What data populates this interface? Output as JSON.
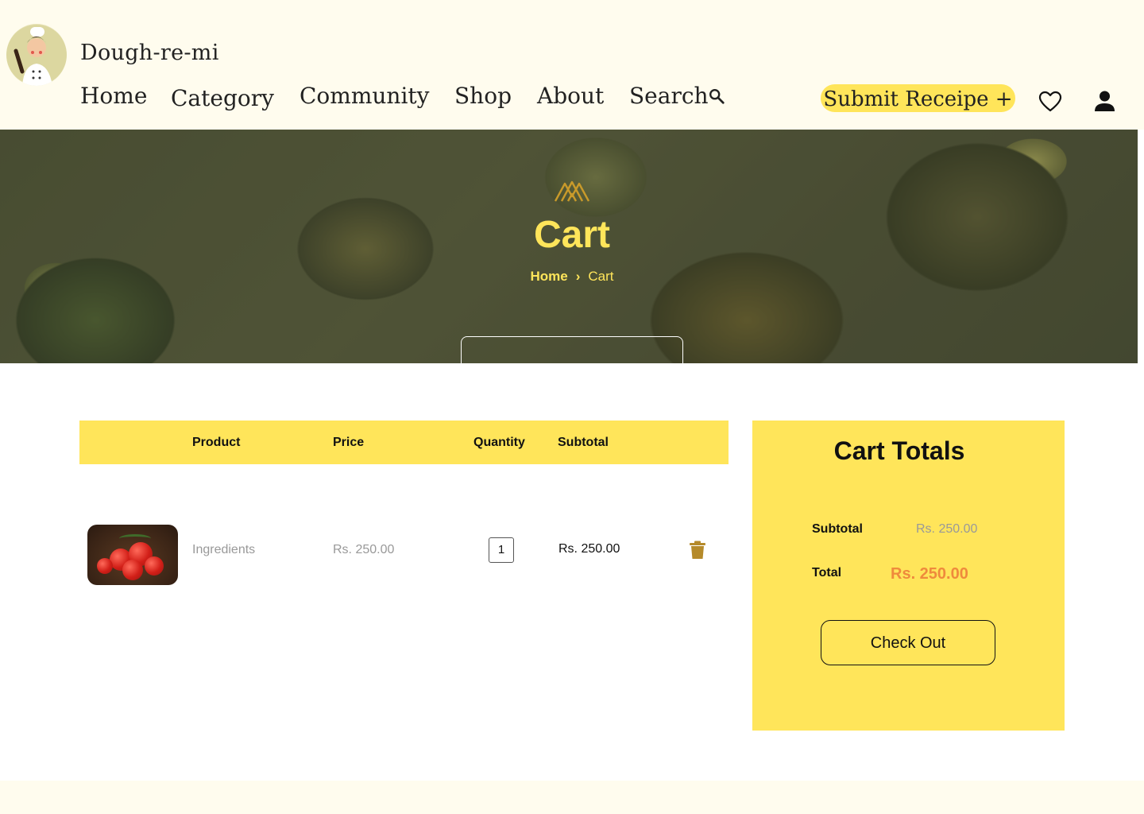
{
  "header": {
    "brand": "Dough-re-mi",
    "nav": {
      "home": "Home",
      "category": "Category",
      "community": "Community",
      "shop": "Shop",
      "about": "About",
      "search": "Search"
    },
    "submit_label": "Submit Receipe +",
    "icons": [
      "search-icon",
      "heart-icon",
      "user-icon"
    ]
  },
  "hero": {
    "title": "Cart",
    "breadcrumb": {
      "home": "Home",
      "separator": "›",
      "current": "Cart"
    }
  },
  "cart": {
    "columns": {
      "product": "Product",
      "price": "Price",
      "quantity": "Quantity",
      "subtotal": "Subtotal"
    },
    "items": [
      {
        "name": "Ingredients",
        "price": "Rs. 250.00",
        "quantity": "1",
        "subtotal": "Rs. 250.00"
      }
    ]
  },
  "totals": {
    "title": "Cart Totals",
    "subtotal_label": "Subtotal",
    "subtotal_value": "Rs. 250.00",
    "total_label": "Total",
    "total_value": "Rs. 250.00",
    "checkout_label": "Check Out"
  },
  "colors": {
    "accent": "#ffe55a",
    "header_bg": "#fffcee",
    "total_value": "#ef8a3c",
    "trash": "#b58a2a"
  }
}
